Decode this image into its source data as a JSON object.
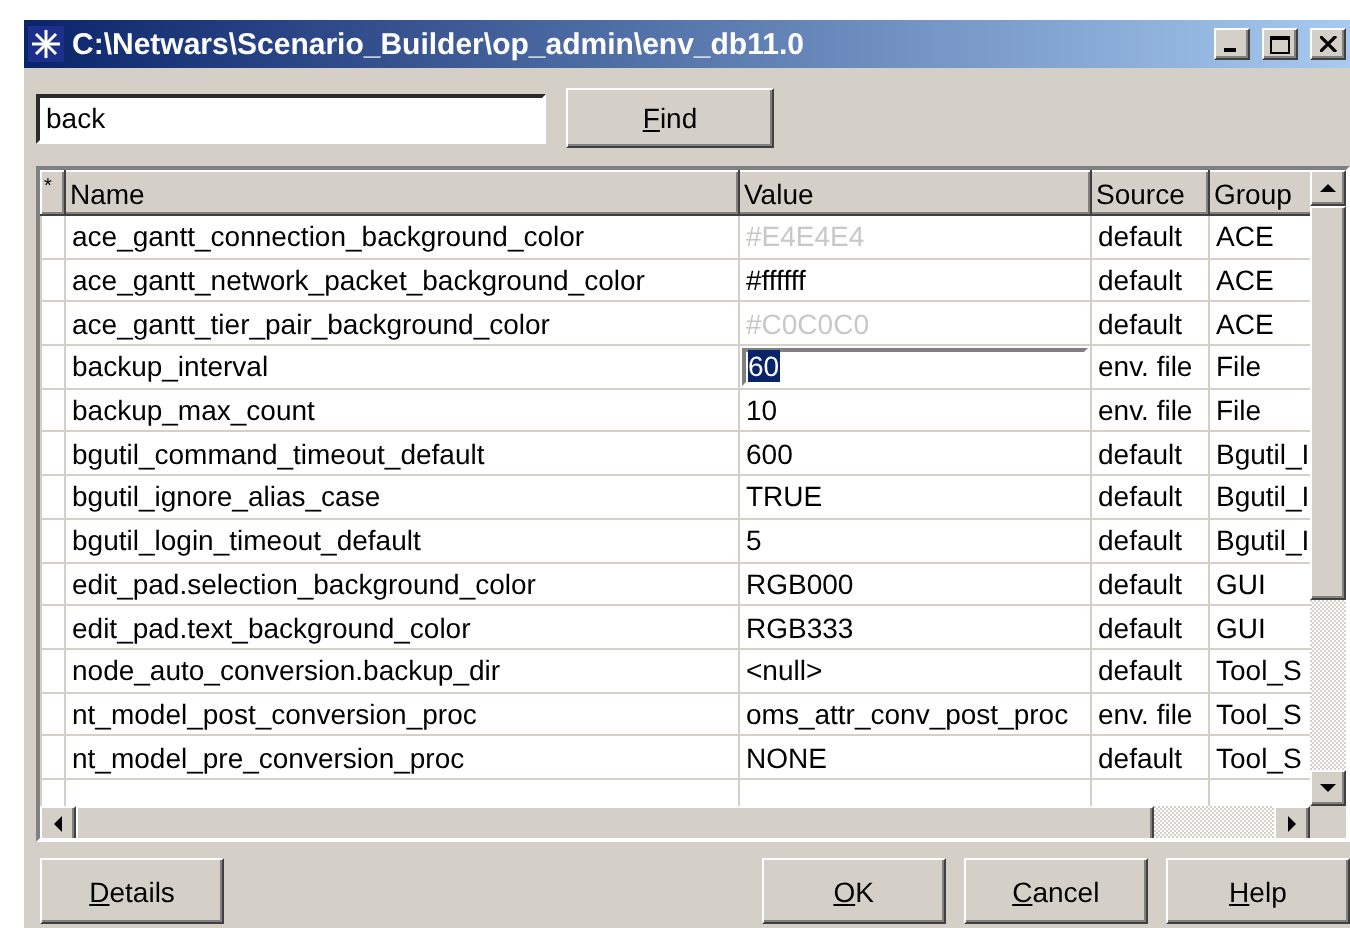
{
  "window": {
    "title": "C:\\Netwars\\Scenario_Builder\\op_admin\\env_db11.0"
  },
  "search": {
    "value": "back",
    "button": "Find"
  },
  "table": {
    "columns": [
      "*",
      "Name",
      "Value",
      "Source",
      "Group"
    ],
    "rows": [
      {
        "name": "ace_gantt_connection_background_color",
        "value": "#E4E4E4",
        "greyed": true,
        "editing": false,
        "source": "default",
        "group": "ACE"
      },
      {
        "name": "ace_gantt_network_packet_background_color",
        "value": "#ffffff",
        "greyed": false,
        "editing": false,
        "source": "default",
        "group": "ACE"
      },
      {
        "name": "ace_gantt_tier_pair_background_color",
        "value": "#C0C0C0",
        "greyed": true,
        "editing": false,
        "source": "default",
        "group": "ACE"
      },
      {
        "name": "backup_interval",
        "value": "60",
        "greyed": false,
        "editing": true,
        "source": "env. file",
        "group": "File"
      },
      {
        "name": "backup_max_count",
        "value": "10",
        "greyed": false,
        "editing": false,
        "source": "env. file",
        "group": "File"
      },
      {
        "name": "bgutil_command_timeout_default",
        "value": "600",
        "greyed": false,
        "editing": false,
        "source": "default",
        "group": "Bgutil_I"
      },
      {
        "name": "bgutil_ignore_alias_case",
        "value": "TRUE",
        "greyed": false,
        "editing": false,
        "source": "default",
        "group": "Bgutil_I"
      },
      {
        "name": "bgutil_login_timeout_default",
        "value": "5",
        "greyed": false,
        "editing": false,
        "source": "default",
        "group": "Bgutil_I"
      },
      {
        "name": "edit_pad.selection_background_color",
        "value": "RGB000",
        "greyed": false,
        "editing": false,
        "source": "default",
        "group": "GUI"
      },
      {
        "name": "edit_pad.text_background_color",
        "value": "RGB333",
        "greyed": false,
        "editing": false,
        "source": "default",
        "group": "GUI"
      },
      {
        "name": "node_auto_conversion.backup_dir",
        "value": "<null>",
        "greyed": false,
        "editing": false,
        "source": "default",
        "group": "Tool_S"
      },
      {
        "name": "nt_model_post_conversion_proc",
        "value": "oms_attr_conv_post_proc",
        "greyed": false,
        "editing": false,
        "source": "env. file",
        "group": "Tool_S"
      },
      {
        "name": "nt_model_pre_conversion_proc",
        "value": "NONE",
        "greyed": false,
        "editing": false,
        "source": "default",
        "group": "Tool_S"
      }
    ]
  },
  "buttons": {
    "left": [
      "Details"
    ],
    "right": [
      "OK",
      "Cancel",
      "Help"
    ]
  }
}
